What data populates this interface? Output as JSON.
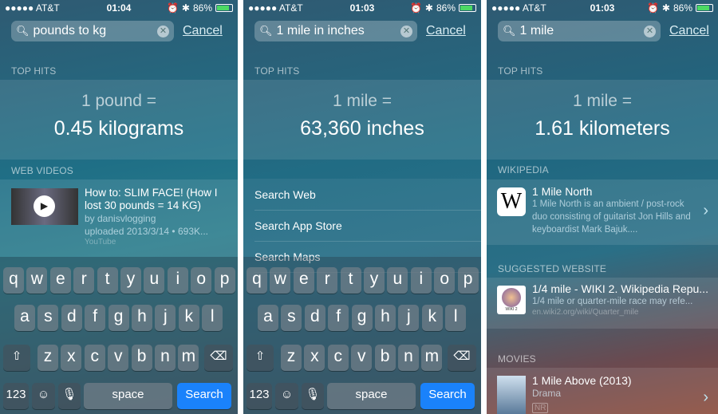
{
  "status": [
    {
      "carrier": "●●●●● AT&T",
      "time": "01:04",
      "battery": "86%",
      "battery_level": 0.86
    },
    {
      "carrier": "●●●●● AT&T",
      "time": "01:03",
      "battery": "86%",
      "battery_level": 0.86
    },
    {
      "carrier": "●●●●● AT&T",
      "time": "01:03",
      "battery": "86%",
      "battery_level": 0.86
    }
  ],
  "search": [
    {
      "value": "pounds to kg"
    },
    {
      "value": "1 mile in inches"
    },
    {
      "value": "1 mile"
    }
  ],
  "cancel_label": "Cancel",
  "top_hits_label": "TOP HITS",
  "top_hits": [
    {
      "line1": "1 pound =",
      "line2": "0.45 kilograms"
    },
    {
      "line1": "1 mile =",
      "line2": "63,360 inches"
    },
    {
      "line1": "1 mile =",
      "line2": "1.61 kilometers"
    }
  ],
  "web_videos": {
    "label": "WEB VIDEOS",
    "title": "How to: SLIM FACE! (How I lost 30 pounds = 14 KG)",
    "by": "by danisvlogging",
    "uploaded": "uploaded 2013/3/14  •  693K...",
    "source": "YouTube"
  },
  "suggestions": [
    "Search Web",
    "Search App Store",
    "Search Maps"
  ],
  "wikipedia": {
    "label": "WIKIPEDIA",
    "logo": "W",
    "title": "1 Mile North",
    "desc": "1 Mile North is an ambient / post-rock duo consisting of guitarist Jon Hills and keyboardist Mark Bajuk...."
  },
  "suggested_website": {
    "label": "SUGGESTED WEBSITE",
    "logo": "WIKI 2",
    "title": "1/4 mile - WIKI 2. Wikipedia Repu...",
    "desc": "1/4 mile or quarter-mile race may refe...",
    "url": "en.wiki2.org/wiki/Quarter_mile"
  },
  "movies": {
    "label": "MOVIES",
    "title": "1 Mile Above (2013)",
    "genre": "Drama",
    "rating": "NR"
  },
  "keyboard": {
    "row1": [
      "q",
      "w",
      "e",
      "r",
      "t",
      "y",
      "u",
      "i",
      "o",
      "p"
    ],
    "row2": [
      "a",
      "s",
      "d",
      "f",
      "g",
      "h",
      "j",
      "k",
      "l"
    ],
    "row3": [
      "z",
      "x",
      "c",
      "v",
      "b",
      "n",
      "m"
    ],
    "shift": "⇧",
    "delete": "⌫",
    "numbers": "123",
    "emoji": "☺",
    "mic": "🎙",
    "space": "space",
    "search": "Search"
  },
  "colors": {
    "accent": "#1a82fb",
    "battery": "#4cd964"
  }
}
